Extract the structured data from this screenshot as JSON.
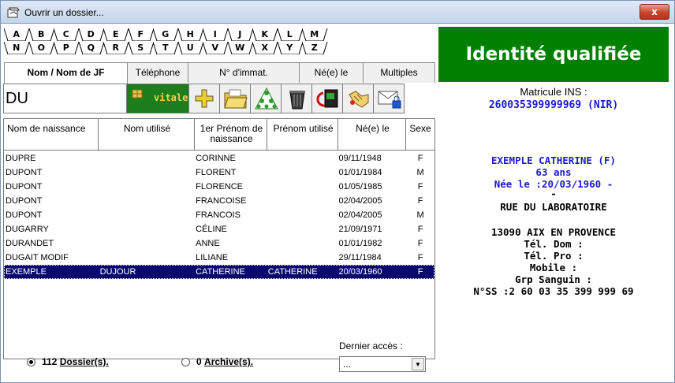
{
  "window": {
    "title": "Ouvrir un dossier...",
    "close_label": "x"
  },
  "letters": {
    "row1": [
      "A",
      "B",
      "C",
      "D",
      "E",
      "F",
      "G",
      "H",
      "I",
      "J",
      "K",
      "L",
      "M"
    ],
    "row2": [
      "N",
      "O",
      "P",
      "Q",
      "R",
      "S",
      "T",
      "U",
      "V",
      "W",
      "X",
      "Y",
      "Z"
    ]
  },
  "search_tabs": [
    "Nom / Nom de JF",
    "Téléphone",
    "N° d'immat.",
    "Né(e) le",
    "Multiples"
  ],
  "search": {
    "value": "DU"
  },
  "toolbar": {
    "vitale_label": "vitale"
  },
  "table": {
    "headers": [
      "Nom de naissance",
      "Nom utilisé",
      "1er Prénom de naissance",
      "Prénom utilisé",
      "Né(e) le",
      "Sexe"
    ],
    "rows": [
      [
        "DUPRE",
        "",
        "CORINNE",
        "",
        "09/11/1948",
        "F"
      ],
      [
        "DUPONT",
        "",
        "FLORENT",
        "",
        "01/01/1984",
        "M"
      ],
      [
        "DUPONT",
        "",
        "FLORENCE",
        "",
        "01/05/1985",
        "F"
      ],
      [
        "DUPONT",
        "",
        "FRANCOISE",
        "",
        "02/04/2005",
        "F"
      ],
      [
        "DUPONT",
        "",
        "FRANCOIS",
        "",
        "02/04/2005",
        "M"
      ],
      [
        "DUGARRY",
        "",
        "CÉLINE",
        "",
        "21/09/1971",
        "F"
      ],
      [
        "DURANDET",
        "",
        "ANNE",
        "",
        "01/01/1982",
        "F"
      ],
      [
        "DUGAIT MODIF",
        "",
        "LILIANE",
        "",
        "29/11/1984",
        "F"
      ],
      [
        "EXEMPLE",
        "DUJOUR",
        "CATHERINE",
        "CATHERINE",
        "20/03/1960",
        "F"
      ]
    ],
    "selected_index": 8
  },
  "footer": {
    "dossiers_count": "112",
    "dossiers_label": "Dossier(s).",
    "archives_count": "0",
    "archives_label": "Archive(s).",
    "last_access_label": "Dernier accès :",
    "last_access_value": "..."
  },
  "identity": {
    "header": "Identité qualifiée",
    "matricule_label": "Matricule INS :",
    "matricule_value": "260035399999969 (NIR)",
    "name_line": "EXEMPLE CATHERINE (F)",
    "age_line": "63 ans",
    "birth_line": "Née le :20/03/1960 -",
    "dash_line": "-",
    "address_line": "RUE DU LABORATOIRE",
    "city_line": "13090 AIX EN PROVENCE",
    "tel_dom": "Tél. Dom :",
    "tel_pro": "Tél. Pro :",
    "mobile": "Mobile :",
    "grp_sanguin": "Grp Sanguin :",
    "nss": "N°SS :2 60 03 35 399 999 69"
  },
  "colors": {
    "accent_green": "#008000",
    "selection": "#0a0a6e",
    "blue_text": "#1a1ad0"
  }
}
